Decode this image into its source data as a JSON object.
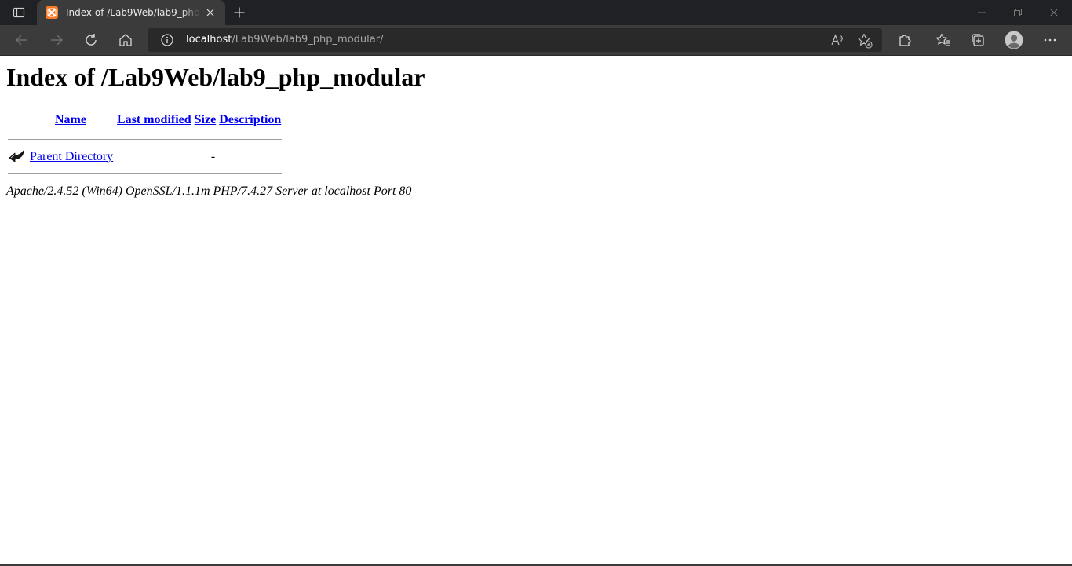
{
  "browser": {
    "tab": {
      "title": "Index of /Lab9Web/lab9_php_modular",
      "favicon": "xampp-icon"
    },
    "address": {
      "host": "localhost",
      "path": "/Lab9Web/lab9_php_modular/"
    },
    "colors": {
      "tabbar": "#202124",
      "toolbar": "#3b3b3b",
      "favicon": "#fb7a24"
    }
  },
  "page": {
    "heading": "Index of /Lab9Web/lab9_php_modular",
    "columns": {
      "name": "Name",
      "last_modified": "Last modified",
      "size": "Size",
      "description": "Description"
    },
    "rows": [
      {
        "icon": "back-arrow-icon",
        "name": "Parent Directory",
        "last_modified": "",
        "size": "-",
        "description": ""
      }
    ],
    "footer": "Apache/2.4.52 (Win64) OpenSSL/1.1.1m PHP/7.4.27 Server at localhost Port 80"
  }
}
